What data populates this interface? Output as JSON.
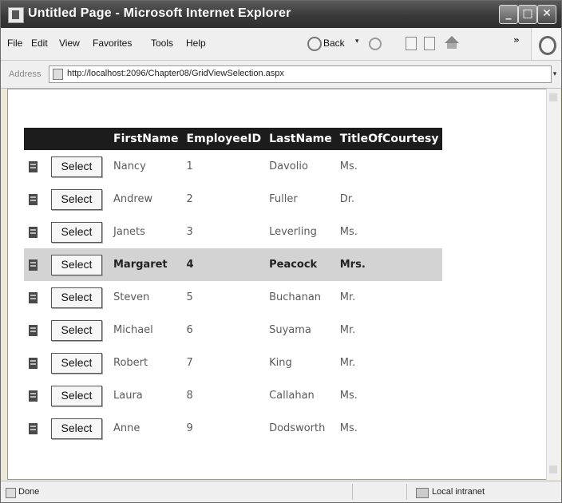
{
  "window": {
    "title": "Untitled Page - Microsoft Internet Explorer",
    "minimize": "_",
    "maximize": "□",
    "close": "✕"
  },
  "menu": {
    "items": [
      "File",
      "Edit",
      "View",
      "Favorites",
      "Tools",
      "Help"
    ]
  },
  "toolbar": {
    "back_label": "Back",
    "back_dropdown": "▾",
    "more": "»"
  },
  "address": {
    "label": "Address",
    "url": "http://localhost:2096/Chapter08/GridViewSelection.aspx",
    "dropdown": "▾"
  },
  "grid": {
    "columns": [
      "FirstName",
      "EmployeeID",
      "LastName",
      "TitleOfCourtesy"
    ],
    "select_label": "Select",
    "selected_index": 3,
    "rows": [
      {
        "first": "Nancy",
        "id": "1",
        "last": "Davolio",
        "title": "Ms."
      },
      {
        "first": "Andrew",
        "id": "2",
        "last": "Fuller",
        "title": "Dr."
      },
      {
        "first": "Janets",
        "id": "3",
        "last": "Leverling",
        "title": "Ms."
      },
      {
        "first": "Margaret",
        "id": "4",
        "last": "Peacock",
        "title": "Mrs."
      },
      {
        "first": "Steven",
        "id": "5",
        "last": "Buchanan",
        "title": "Mr."
      },
      {
        "first": "Michael",
        "id": "6",
        "last": "Suyama",
        "title": "Mr."
      },
      {
        "first": "Robert",
        "id": "7",
        "last": "King",
        "title": "Mr."
      },
      {
        "first": "Laura",
        "id": "8",
        "last": "Callahan",
        "title": "Ms."
      },
      {
        "first": "Anne",
        "id": "9",
        "last": "Dodsworth",
        "title": "Ms."
      }
    ]
  },
  "status": {
    "text": "Done",
    "zone": "Local intranet"
  }
}
